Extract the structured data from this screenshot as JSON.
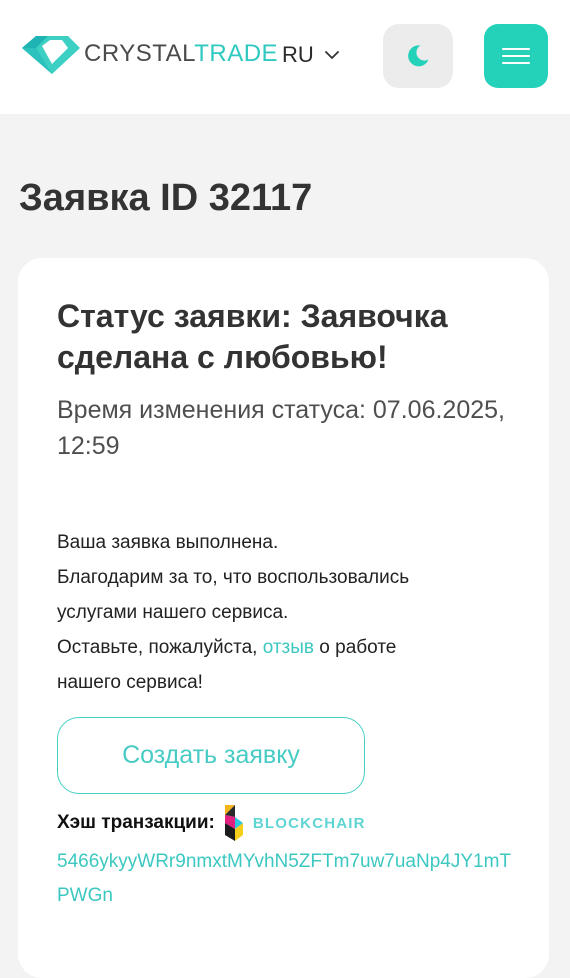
{
  "header": {
    "logo_part1": "CRYSTAL",
    "logo_part2": "TRADE",
    "language": "RU",
    "theme_icon": "moon-icon",
    "menu_icon": "hamburger-icon"
  },
  "page": {
    "title": "Заявка ID 32117"
  },
  "card": {
    "status_title": "Статус заявки: Заявочка сделана с любовью!",
    "status_time": "Время изменения статуса: 07.06.2025, 12:59",
    "message": {
      "line1": "Ваша заявка выполнена.",
      "line2": "Благодарим за то, что воспользовались",
      "line3": "услугами нашего сервиса.",
      "line4_before": "Оставьте, пожалуйста, ",
      "line4_link": "отзыв",
      "line4_after": " о работе",
      "line5": "нашего сервиса!"
    },
    "create_button": "Создать заявку",
    "hash_label": "Хэш транзакции:",
    "explorer_name": "BLOCKCHAIR",
    "hash_value": "5466ykyyWRr9nmxtMYvhN5ZFTm7uw7uaNp4JY1mTPWGn"
  },
  "colors": {
    "accent": "#23d2b9",
    "link": "#3cc8c1",
    "background": "#f3f3f3"
  }
}
